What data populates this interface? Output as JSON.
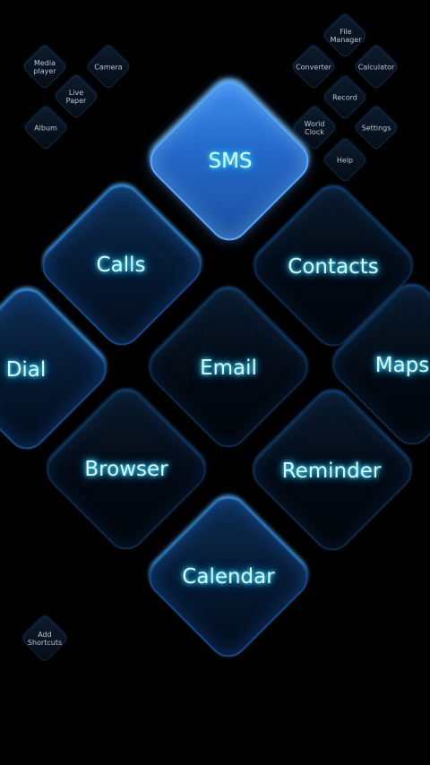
{
  "main_tiles": {
    "sms": "SMS",
    "calls": "Calls",
    "contacts": "Contacts",
    "dial": "Dial",
    "email": "Email",
    "maps": "Maps",
    "browser": "Browser",
    "reminder": "Reminder",
    "calendar": "Calendar"
  },
  "left_cluster": {
    "media_player": "Media\nplayer",
    "camera": "Camera",
    "live_paper": "Live\nPaper",
    "album": "Album"
  },
  "right_cluster": {
    "file_manager": "File\nManager",
    "converter": "Converter",
    "calculator": "Calculator",
    "record": "Record",
    "world_clock": "World\nClock",
    "settings": "Settings",
    "help": "Help"
  },
  "add_shortcuts": "Add\nShortcuts"
}
